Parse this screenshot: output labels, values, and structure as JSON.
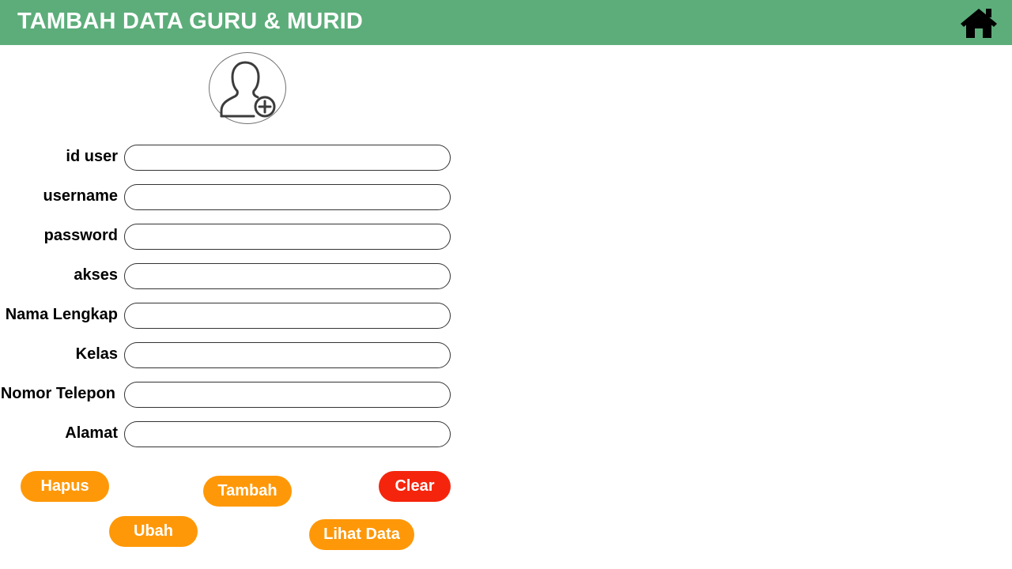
{
  "header": {
    "title": "TAMBAH DATA GURU & MURID",
    "home_icon": "home-icon",
    "background": "#5cad7a"
  },
  "avatar": {
    "icon": "add-user-icon"
  },
  "form": {
    "fields": [
      {
        "key": "id_user",
        "label": "id user",
        "value": ""
      },
      {
        "key": "username",
        "label": "username",
        "value": ""
      },
      {
        "key": "password",
        "label": "password",
        "value": ""
      },
      {
        "key": "akses",
        "label": "akses",
        "value": ""
      },
      {
        "key": "nama_lengkap",
        "label": "Nama Lengkap",
        "value": ""
      },
      {
        "key": "kelas",
        "label": "Kelas",
        "value": ""
      },
      {
        "key": "nomor_telepon",
        "label": "Nomor Telepon",
        "value": ""
      },
      {
        "key": "alamat",
        "label": "Alamat",
        "value": ""
      }
    ]
  },
  "buttons": {
    "hapus": "Hapus",
    "tambah": "Tambah",
    "clear": "Clear",
    "ubah": "Ubah",
    "lihat_data": "Lihat Data"
  },
  "colors": {
    "accent_orange": "#ff9808",
    "accent_red": "#f5250d"
  }
}
